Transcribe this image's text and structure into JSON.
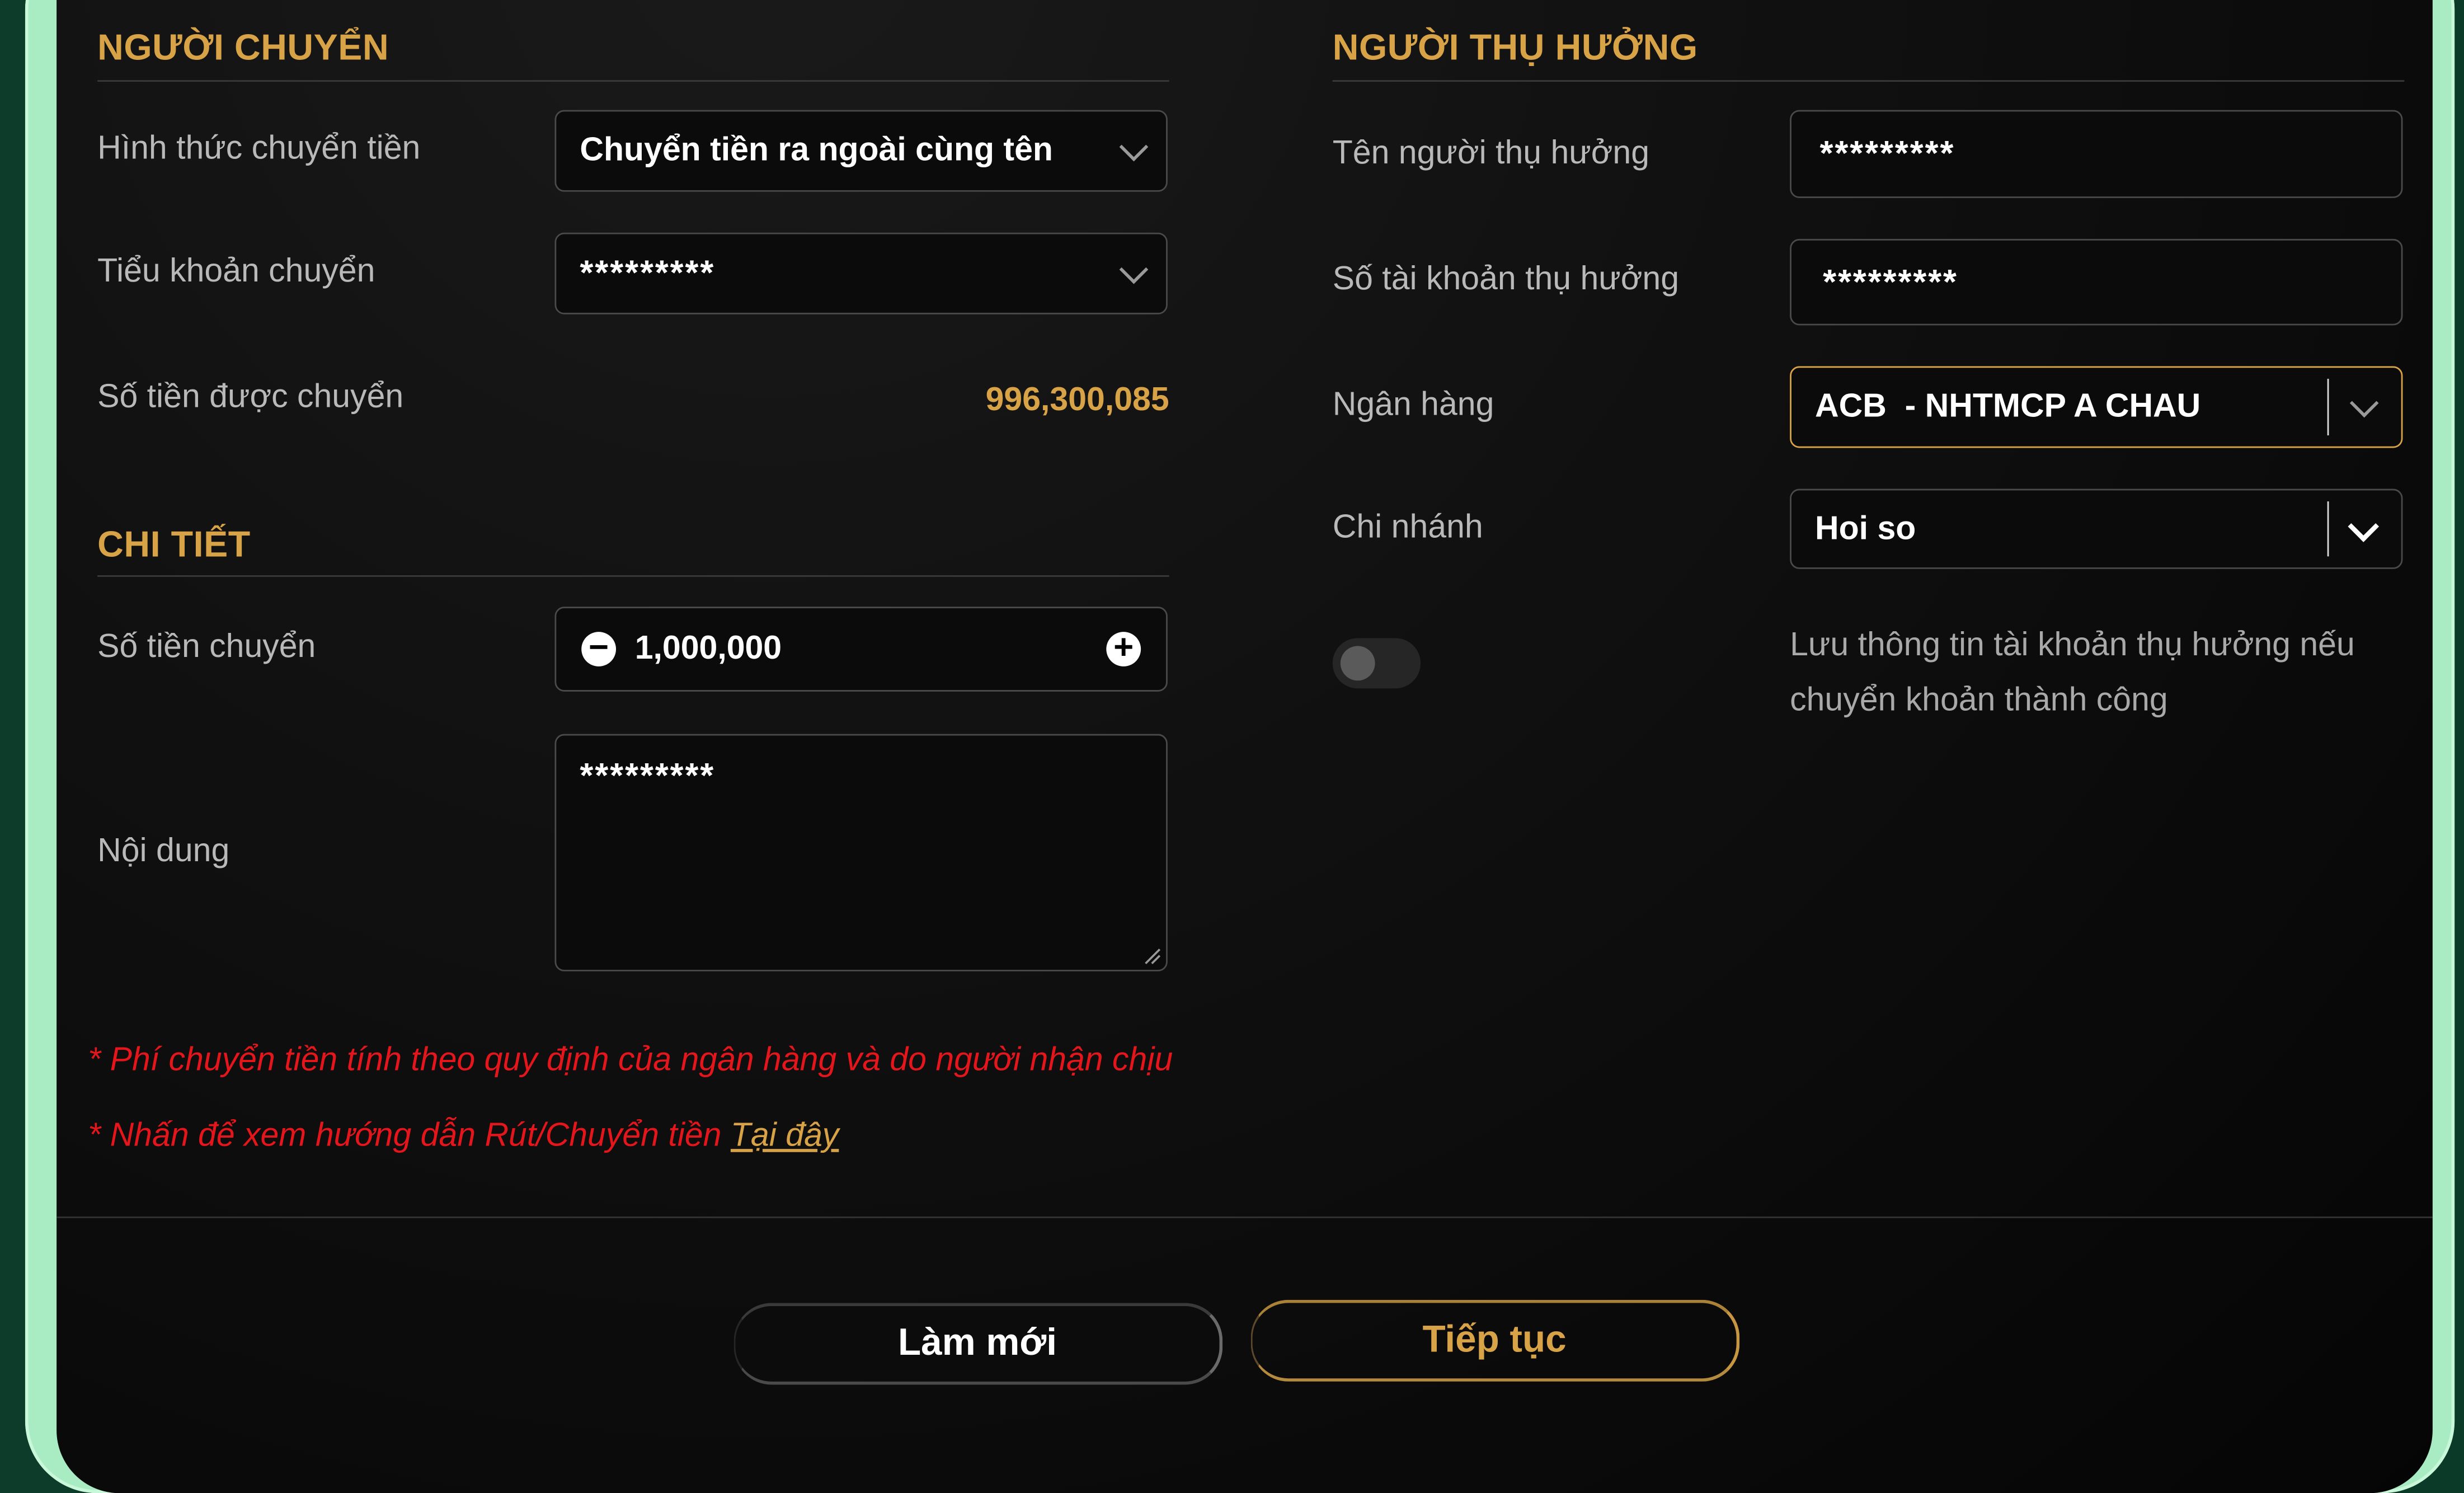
{
  "sender": {
    "title": "NGƯỜI CHUYỂN",
    "transfer_type_label": "Hình thức chuyển tiền",
    "transfer_type_value": "Chuyển tiền ra ngoài cùng tên",
    "sub_account_label": "Tiểu khoản chuyển",
    "sub_account_value": "*********",
    "available_label": "Số tiền được chuyển",
    "available_value": "996,300,085"
  },
  "details": {
    "title": "CHI TIẾT",
    "amount_label": "Số tiền chuyển",
    "amount_value": "1,000,000",
    "content_label": "Nội dung",
    "content_value": "*********"
  },
  "beneficiary": {
    "title": "NGƯỜI THỤ HƯỞNG",
    "name_label": "Tên người thụ hưởng",
    "name_value": "*********",
    "account_label": "Số tài khoản thụ hưởng",
    "account_value": "*********",
    "bank_label": "Ngân hàng",
    "bank_value": "ACB  - NHTMCP A CHAU",
    "branch_label": "Chi nhánh",
    "branch_value": "Hoi so",
    "save_info_line1": "Lưu thông tin tài khoản thụ hưởng nếu",
    "save_info_line2": "chuyển khoản thành công",
    "save_info_enabled": false
  },
  "notes": {
    "fee_note": "* Phí chuyển tiền tính theo quy định của ngân hàng và do người nhận chịu",
    "guide_note": "* Nhấn để xem hướng dẫn Rút/Chuyển tiền",
    "guide_link": "Tại đây"
  },
  "actions": {
    "reset_label": "Làm mới",
    "continue_label": "Tiếp tục"
  },
  "colors": {
    "accent": "#d8a347",
    "warning": "#e4161c",
    "frame": "#a9ecc4"
  },
  "icons": {
    "dropdown": "chevron-down-icon",
    "decrease": "minus-circle-icon",
    "increase": "plus-circle-icon",
    "resize": "resize-grip-icon"
  }
}
